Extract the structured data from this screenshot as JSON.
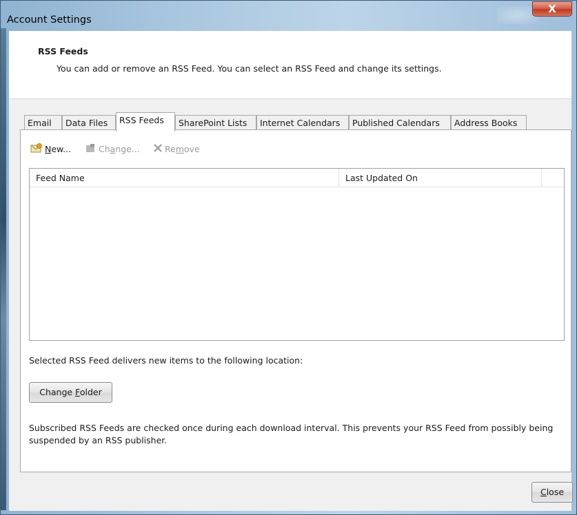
{
  "window": {
    "title": "Account Settings",
    "close_glyph": "X"
  },
  "header": {
    "title": "RSS Feeds",
    "description": "You can add or remove an RSS Feed. You can select an RSS Feed and change its settings."
  },
  "tabs": [
    {
      "label": "Email"
    },
    {
      "label": "Data Files"
    },
    {
      "label": "RSS Feeds",
      "active": true
    },
    {
      "label": "SharePoint Lists"
    },
    {
      "label": "Internet Calendars"
    },
    {
      "label": "Published Calendars"
    },
    {
      "label": "Address Books"
    }
  ],
  "toolbar": {
    "new_prefix": "N",
    "new_rest": "ew...",
    "change_prefix": "Ch",
    "change_accel": "a",
    "change_rest": "nge...",
    "remove_prefix": "Re",
    "remove_accel": "m",
    "remove_rest": "ove"
  },
  "list": {
    "columns": [
      "Feed Name",
      "Last Updated On"
    ],
    "rows": []
  },
  "location": {
    "text": "Selected RSS Feed delivers new items to the following location:"
  },
  "change_folder": {
    "prefix": "Change ",
    "accel": "F",
    "rest": "older"
  },
  "info": {
    "text": "Subscribed RSS Feeds are checked once during each download interval. This prevents your RSS Feed from possibly being suspended by an RSS publisher."
  },
  "close": {
    "accel": "C",
    "rest": "lose"
  },
  "colors": {
    "accent": "#c23a22",
    "frame": "#a9c6df",
    "tab_border": "#a8a8a8"
  }
}
